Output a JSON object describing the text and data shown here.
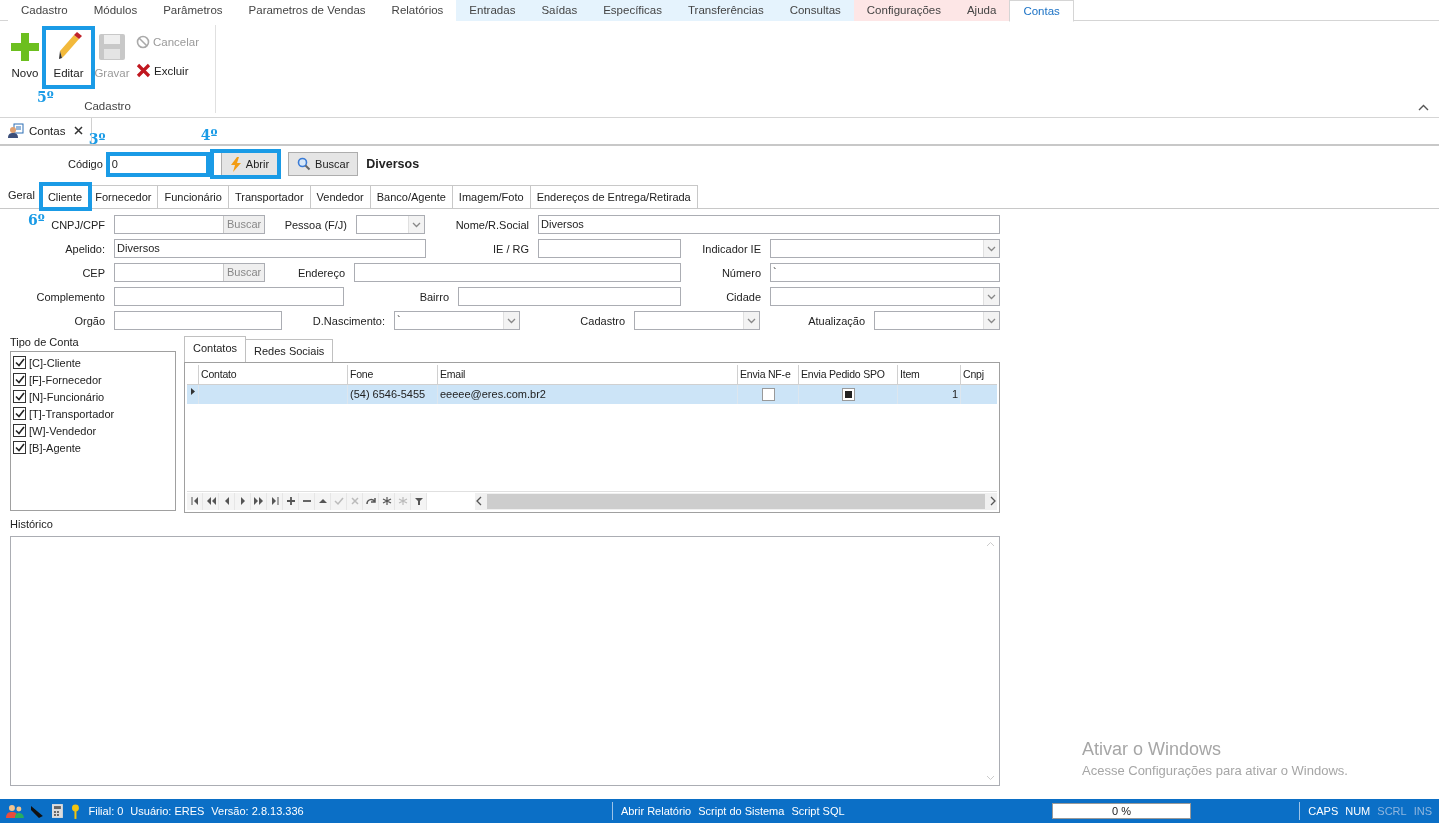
{
  "menu_tabs": [
    {
      "label": "Cadastro",
      "selected": false,
      "color": "#ffffff"
    },
    {
      "label": "Módulos",
      "selected": false,
      "color": "#ffffff"
    },
    {
      "label": "Parâmetros",
      "selected": false,
      "color": "#ffffff"
    },
    {
      "label": "Parametros de Vendas",
      "selected": false,
      "color": "#ffffff"
    },
    {
      "label": "Relatórios",
      "selected": false,
      "color": "#ffffff"
    },
    {
      "label": "Entradas",
      "selected": false,
      "color": "#e5f3fd"
    },
    {
      "label": "Saídas",
      "selected": false,
      "color": "#e5f3fd"
    },
    {
      "label": "Específicas",
      "selected": false,
      "color": "#e5f3fd"
    },
    {
      "label": "Transferências",
      "selected": false,
      "color": "#e5f3fd"
    },
    {
      "label": "Consultas",
      "selected": false,
      "color": "#e5f3fd"
    },
    {
      "label": "Configurações",
      "selected": false,
      "color": "#fde6e6"
    },
    {
      "label": "Ajuda",
      "selected": false,
      "color": "#fde6e6"
    },
    {
      "label": "Contas",
      "selected": true,
      "color": "#ffffff"
    }
  ],
  "ribbon": {
    "group_label": "Cadastro",
    "buttons": [
      {
        "label": "Novo",
        "kind": "new",
        "disabled": false
      },
      {
        "label": "Editar",
        "kind": "edit",
        "disabled": false,
        "callout": "5º"
      },
      {
        "label": "Gravar",
        "kind": "save",
        "disabled": true
      },
      {
        "label": "Cancelar",
        "kind": "cancel",
        "disabled": true
      },
      {
        "label": "Excluir",
        "kind": "delete",
        "disabled": false
      }
    ]
  },
  "document_tab": {
    "title": "Contas"
  },
  "code_row": {
    "label": "Código",
    "value": "0",
    "callout": "3º",
    "open_button": {
      "label": "Abrir",
      "callout": "4º"
    },
    "search_button": {
      "label": "Buscar"
    },
    "name": "Diversos"
  },
  "section_tabs": [
    {
      "label": "Geral",
      "selected": true
    },
    {
      "label": "Cliente",
      "selected": false,
      "callout": "6º"
    },
    {
      "label": "Fornecedor",
      "selected": false
    },
    {
      "label": "Funcionário",
      "selected": false
    },
    {
      "label": "Transportador",
      "selected": false
    },
    {
      "label": "Vendedor",
      "selected": false
    },
    {
      "label": "Banco/Agente",
      "selected": false
    },
    {
      "label": "Imagem/Foto",
      "selected": false
    },
    {
      "label": "Endereços de Entrega/Retirada",
      "selected": false
    }
  ],
  "form": {
    "rows": [
      [
        {
          "label": "CNPJ/CPF",
          "kind": "search",
          "button": "Buscar"
        },
        {
          "label": "Pessoa (F/J)",
          "kind": "combo"
        },
        {
          "label": "Nome/R.Social",
          "kind": "text",
          "value": "Diversos"
        }
      ],
      [
        {
          "label": "Apelido:",
          "kind": "text",
          "value": "Diversos"
        },
        {
          "label": "IE / RG",
          "kind": "text"
        },
        {
          "label": "Indicador IE",
          "kind": "combo"
        }
      ],
      [
        {
          "label": "CEP",
          "kind": "search",
          "button": "Buscar"
        },
        {
          "label": "Endereço",
          "kind": "text"
        },
        {
          "label": "Número",
          "kind": "text",
          "value": "`"
        }
      ],
      [
        {
          "label": "Complemento",
          "kind": "text"
        },
        {
          "label": "Bairro",
          "kind": "text"
        },
        {
          "label": "Cidade",
          "kind": "combo"
        }
      ],
      [
        {
          "label": "Orgão",
          "kind": "text"
        },
        {
          "label": "D.Nascimento:",
          "kind": "combo",
          "value": "`"
        },
        {
          "label": "Cadastro",
          "kind": "combo"
        },
        {
          "label": "Atualização",
          "kind": "combo"
        }
      ]
    ]
  },
  "account_types": {
    "title": "Tipo de Conta",
    "items": [
      {
        "label": "[C]-Cliente",
        "checked": true
      },
      {
        "label": "[F]-Fornecedor",
        "checked": true
      },
      {
        "label": "[N]-Funcionário",
        "checked": true
      },
      {
        "label": "[T]-Transportador",
        "checked": true
      },
      {
        "label": "[W]-Vendedor",
        "checked": true
      },
      {
        "label": "[B]-Agente",
        "checked": true
      }
    ]
  },
  "contacts": {
    "tabs": [
      {
        "label": "Contatos",
        "selected": true
      },
      {
        "label": "Redes Sociais",
        "selected": false
      }
    ],
    "table": {
      "columns": [
        "Contato",
        "Fone",
        "Email",
        "Envia NF-e",
        "Envia Pedido SPO",
        "Item",
        "Cnpj"
      ],
      "rows": [
        {
          "selected": true,
          "fone": "(54) 6546-5455",
          "email": "eeeee@eres.com.br2",
          "envia_nfe": false,
          "envia_pedido_spo": true,
          "item": "1"
        }
      ]
    }
  },
  "history": {
    "label": "Histórico"
  },
  "os_notice": {
    "title": "Ativar o Windows",
    "text": "Acesse Configurações para ativar o Windows."
  },
  "status_bar": {
    "info": [
      "Filial: 0",
      "Usuário: ERES",
      "Versão: 2.8.13.336"
    ],
    "links": [
      "Abrir Relatório",
      "Script do Sistema",
      "Script SQL"
    ],
    "progress": {
      "label": "0 %",
      "level": 0
    },
    "keys": [
      {
        "label": "CAPS",
        "on": true
      },
      {
        "label": "NUM",
        "on": true
      },
      {
        "label": "SCRL",
        "on": false
      },
      {
        "label": "INS",
        "on": false
      }
    ]
  }
}
